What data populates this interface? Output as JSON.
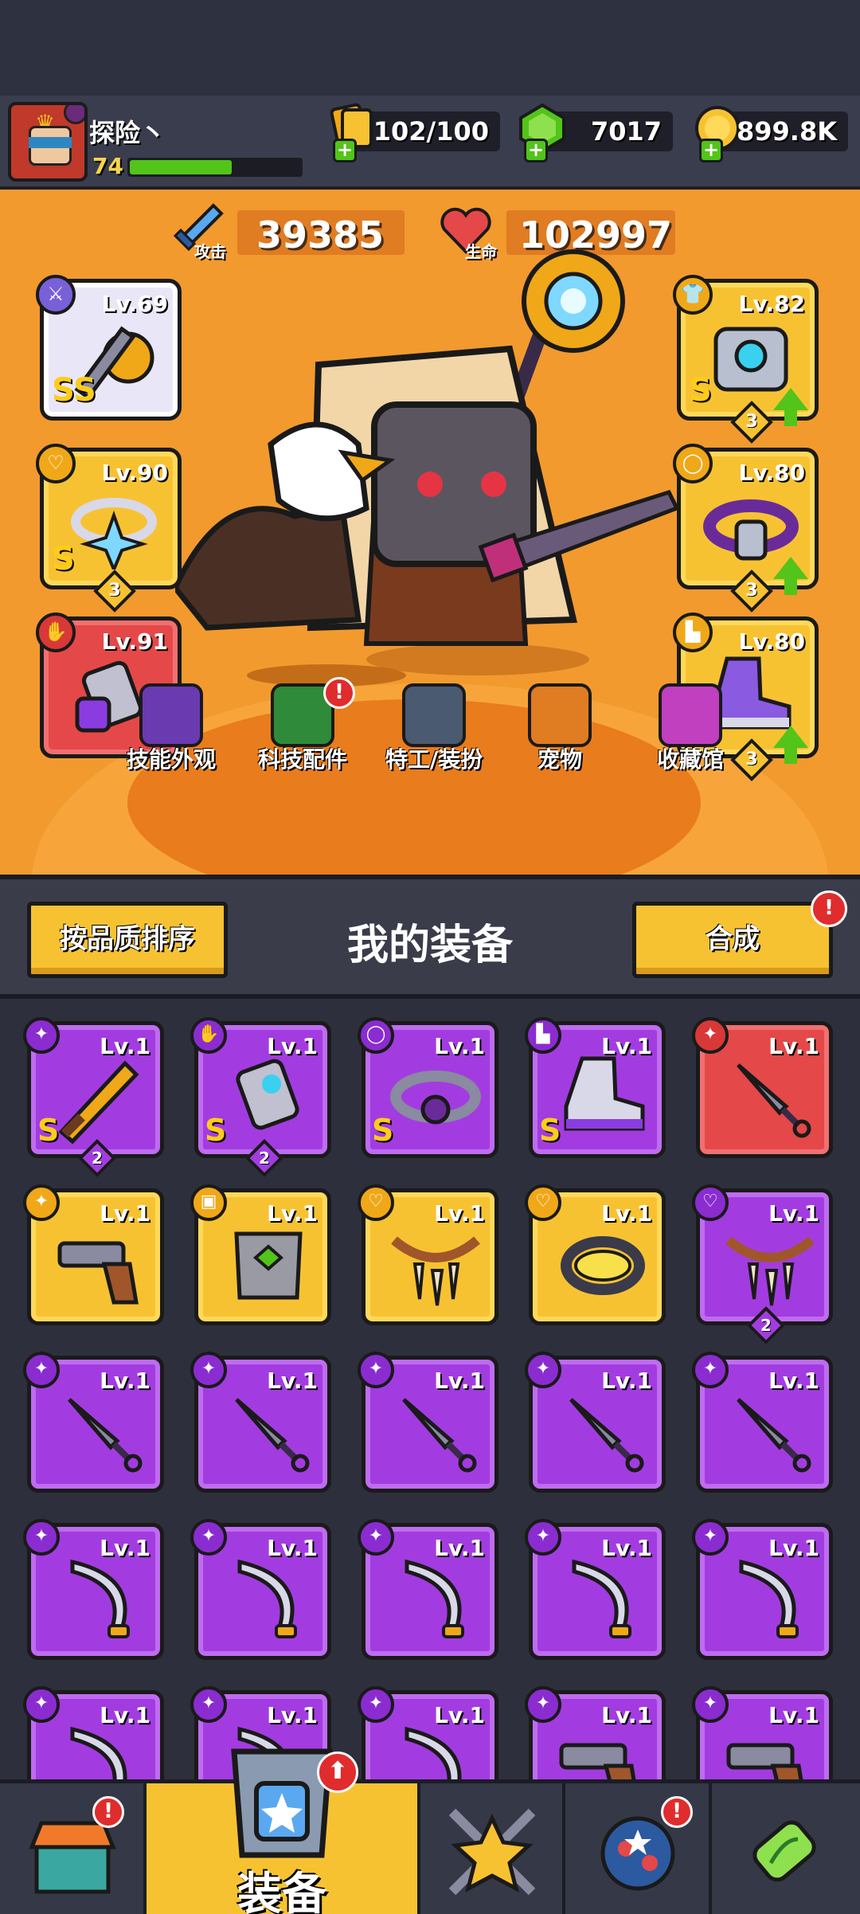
{
  "player": {
    "name": "探险丶",
    "level": "74",
    "xp_fraction": 0.6
  },
  "resources": {
    "energy": {
      "value": "102/100",
      "icon": "energy-cards-icon"
    },
    "gems": {
      "value": "7017",
      "icon": "green-gem-icon"
    },
    "coins": {
      "value": "899.8K",
      "icon": "gold-coin-icon"
    }
  },
  "stats": {
    "attack": {
      "label": "攻击",
      "value": "39385"
    },
    "hp": {
      "label": "生命",
      "value": "102997"
    }
  },
  "equipped": {
    "weapon": {
      "level": "Lv.69",
      "grade": "SS",
      "rarity": "white"
    },
    "necklace": {
      "level": "Lv.90",
      "grade": "S",
      "stars": "3",
      "rarity": "gold"
    },
    "gloves": {
      "level": "Lv.91",
      "rarity": "red"
    },
    "armor": {
      "level": "Lv.82",
      "grade": "S",
      "stars": "3",
      "rarity": "gold",
      "upgradable": true
    },
    "belt": {
      "level": "Lv.80",
      "stars": "3",
      "rarity": "gold",
      "upgradable": true
    },
    "boots": {
      "level": "Lv.80",
      "stars": "3",
      "rarity": "gold",
      "upgradable": true
    }
  },
  "hero_nav": [
    {
      "label": "技能外观",
      "icon": "soccer-skin-icon",
      "badge": ""
    },
    {
      "label": "科技配件",
      "icon": "tech-part-icon",
      "badge": "!"
    },
    {
      "label": "特工/装扮",
      "icon": "agent-icon",
      "badge": ""
    },
    {
      "label": "宠物",
      "icon": "pet-dog-icon",
      "badge": ""
    },
    {
      "label": "收藏馆",
      "icon": "collection-chest-icon",
      "badge": ""
    }
  ],
  "section": {
    "sort_button": "按品质排序",
    "title": "我的装备",
    "merge_button": "合成",
    "merge_badge": "!"
  },
  "inventory": [
    {
      "level": "Lv.1",
      "rarity": "purple",
      "grade": "S",
      "stars": "2",
      "item": "flame-sword"
    },
    {
      "level": "Lv.1",
      "rarity": "purple",
      "grade": "S",
      "stars": "2",
      "item": "mech-gauntlet"
    },
    {
      "level": "Lv.1",
      "rarity": "purple",
      "grade": "S",
      "stars": "",
      "item": "orb-belt"
    },
    {
      "level": "Lv.1",
      "rarity": "purple",
      "grade": "S",
      "stars": "",
      "item": "speed-boots"
    },
    {
      "level": "Lv.1",
      "rarity": "red",
      "grade": "",
      "stars": "",
      "item": "kunai"
    },
    {
      "level": "Lv.1",
      "rarity": "gold",
      "grade": "",
      "stars": "",
      "item": "revolver"
    },
    {
      "level": "Lv.1",
      "rarity": "gold",
      "grade": "",
      "stars": "",
      "item": "stone-armor"
    },
    {
      "level": "Lv.1",
      "rarity": "gold",
      "grade": "",
      "stars": "",
      "item": "fang-necklace"
    },
    {
      "level": "Lv.1",
      "rarity": "gold",
      "grade": "",
      "stars": "",
      "item": "spike-collar"
    },
    {
      "level": "Lv.1",
      "rarity": "purple",
      "grade": "",
      "stars": "2",
      "item": "fang-necklace"
    },
    {
      "level": "Lv.1",
      "rarity": "purple",
      "grade": "",
      "stars": "",
      "item": "kunai"
    },
    {
      "level": "Lv.1",
      "rarity": "purple",
      "grade": "",
      "stars": "",
      "item": "kunai"
    },
    {
      "level": "Lv.1",
      "rarity": "purple",
      "grade": "",
      "stars": "",
      "item": "kunai"
    },
    {
      "level": "Lv.1",
      "rarity": "purple",
      "grade": "",
      "stars": "",
      "item": "kunai"
    },
    {
      "level": "Lv.1",
      "rarity": "purple",
      "grade": "",
      "stars": "",
      "item": "kunai"
    },
    {
      "level": "Lv.1",
      "rarity": "purple",
      "grade": "",
      "stars": "",
      "item": "scimitar"
    },
    {
      "level": "Lv.1",
      "rarity": "purple",
      "grade": "",
      "stars": "",
      "item": "scimitar"
    },
    {
      "level": "Lv.1",
      "rarity": "purple",
      "grade": "",
      "stars": "",
      "item": "scimitar"
    },
    {
      "level": "Lv.1",
      "rarity": "purple",
      "grade": "",
      "stars": "",
      "item": "scimitar"
    },
    {
      "level": "Lv.1",
      "rarity": "purple",
      "grade": "",
      "stars": "",
      "item": "scimitar"
    },
    {
      "level": "Lv.1",
      "rarity": "purple",
      "grade": "",
      "stars": "",
      "item": "scimitar"
    },
    {
      "level": "Lv.1",
      "rarity": "purple",
      "grade": "",
      "stars": "",
      "item": "scimitar"
    },
    {
      "level": "Lv.1",
      "rarity": "purple",
      "grade": "",
      "stars": "",
      "item": "scimitar"
    },
    {
      "level": "Lv.1",
      "rarity": "purple",
      "grade": "",
      "stars": "",
      "item": "revolver"
    },
    {
      "level": "Lv.1",
      "rarity": "purple",
      "grade": "",
      "stars": "",
      "item": "revolver"
    }
  ],
  "tabs": [
    {
      "name": "shop",
      "label": "",
      "icon": "shop-stall-icon",
      "badge": "!",
      "active": false
    },
    {
      "name": "equipment",
      "label": "装备",
      "icon": "equipment-armor-icon",
      "badge": "⬆",
      "active": true
    },
    {
      "name": "battle",
      "label": "",
      "icon": "crossed-swords-star-icon",
      "badge": "",
      "active": false
    },
    {
      "name": "events",
      "label": "",
      "icon": "star-planet-icon",
      "badge": "!",
      "active": false
    },
    {
      "name": "lab",
      "label": "",
      "icon": "dna-capsule-icon",
      "badge": "",
      "active": false
    }
  ],
  "colors": {
    "hero_bg": "#f29a2e",
    "purple_rarity": "#a23ce0",
    "gold_rarity": "#f7c232",
    "red_rarity": "#e54848",
    "upgrade_green": "#52c41a",
    "alert_red": "#e02c2c"
  }
}
